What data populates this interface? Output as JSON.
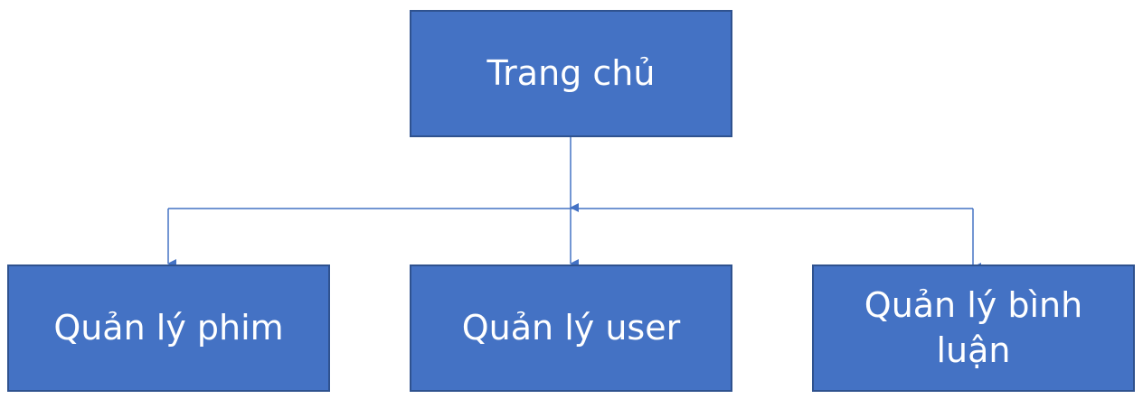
{
  "diagram": {
    "colors": {
      "node_fill": "#4472c4",
      "node_border": "#2f528f",
      "node_text": "#ffffff",
      "connector": "#4472c4"
    },
    "root": {
      "label": "Trang chủ"
    },
    "children": [
      {
        "label": "Quản lý phim"
      },
      {
        "label": "Quản lý user"
      },
      {
        "label": "Quản lý bình luận"
      }
    ]
  }
}
